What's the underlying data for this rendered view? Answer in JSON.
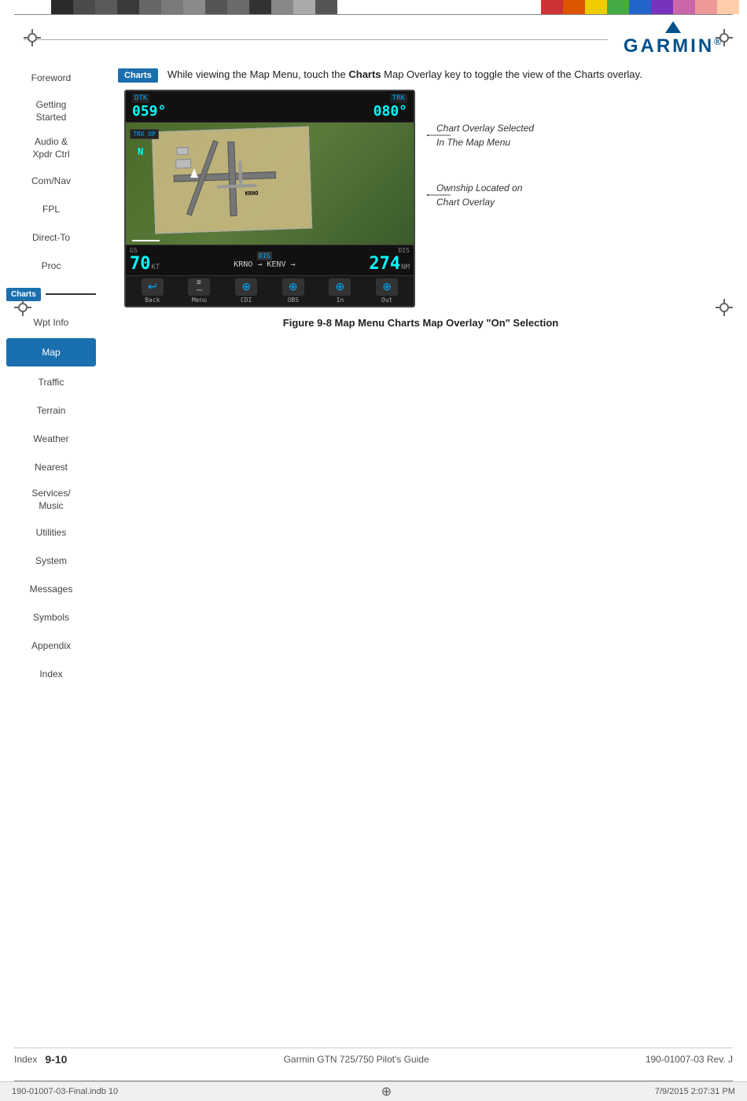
{
  "topBar": {
    "leftColors": [
      "#2a2a2a",
      "#4a4a4a",
      "#6a6a6a",
      "#3a3a3a",
      "#5a5a5a",
      "#7a7a7a",
      "#9a9a9a",
      "#4a4a4a",
      "#6a6a6a",
      "#2a2a2a",
      "#8a8a8a",
      "#aaaaaa",
      "#5a5a5a"
    ],
    "rightColors": [
      "#cc3333",
      "#ee6600",
      "#eecc00",
      "#44aa44",
      "#2266cc",
      "#8833cc",
      "#cc66aa",
      "#ee8888",
      "#ffccaa"
    ]
  },
  "garmin": {
    "logoText": "GARMIN",
    "reg": "®"
  },
  "sidebar": {
    "items": [
      {
        "label": "Foreword",
        "active": false
      },
      {
        "label": "Getting\nStarted",
        "active": false
      },
      {
        "label": "Audio &\nXpdr Ctrl",
        "active": false
      },
      {
        "label": "Com/Nav",
        "active": false
      },
      {
        "label": "FPL",
        "active": false
      },
      {
        "label": "Direct-To",
        "active": false
      },
      {
        "label": "Proc",
        "active": false
      },
      {
        "label": "Charts",
        "active": false,
        "hasBadge": true
      },
      {
        "label": "Wpt Info",
        "active": false
      },
      {
        "label": "Map",
        "active": true
      },
      {
        "label": "Traffic",
        "active": false
      },
      {
        "label": "Terrain",
        "active": false
      },
      {
        "label": "Weather",
        "active": false
      },
      {
        "label": "Nearest",
        "active": false
      },
      {
        "label": "Services/\nMusic",
        "active": false
      },
      {
        "label": "Utilities",
        "active": false
      },
      {
        "label": "System",
        "active": false
      },
      {
        "label": "Messages",
        "active": false
      },
      {
        "label": "Symbols",
        "active": false
      },
      {
        "label": "Appendix",
        "active": false
      },
      {
        "label": "Index",
        "active": false
      }
    ]
  },
  "content": {
    "introText1": "While viewing the Map Menu, touch the ",
    "introTextBold": "Charts",
    "introText2": " Map Overlay key to toggle the view of the Charts overlay.",
    "chartsButtonLabel": "Charts",
    "annotations": [
      {
        "text": "Chart Overlay Selected\nIn The Map Menu"
      },
      {
        "text": "Ownship Located on\nChart Overlay"
      }
    ],
    "figureCaption": "Figure 9-8  Map Menu Charts Map Overlay \"On\" Selection"
  },
  "gpsScreen": {
    "topLeft": "DTK",
    "topLeftValue": "059°",
    "topRight": "TRK",
    "topRightValue": "080°",
    "labelTrxUp": "TRX UP",
    "northLabel": "N",
    "krnoLabel": "KRNO",
    "speedValue": "70",
    "speedUnit": "KT",
    "routeLabel": "KRNO → KENV →",
    "distValue": "274",
    "distUnit": "NM",
    "bottomLabel": "DIS",
    "buttons": [
      "Back",
      "Menu",
      "CDI",
      "OBS",
      "In",
      "Out"
    ]
  },
  "footer": {
    "pageNum": "9-10",
    "centerText": "Garmin GTN 725/750 Pilot's Guide",
    "rightText": "190-01007-03  Rev. J"
  },
  "printInfo": {
    "leftText": "190-01007-03-Final.indb  10",
    "rightText": "7/9/2015  2:07:31 PM"
  }
}
